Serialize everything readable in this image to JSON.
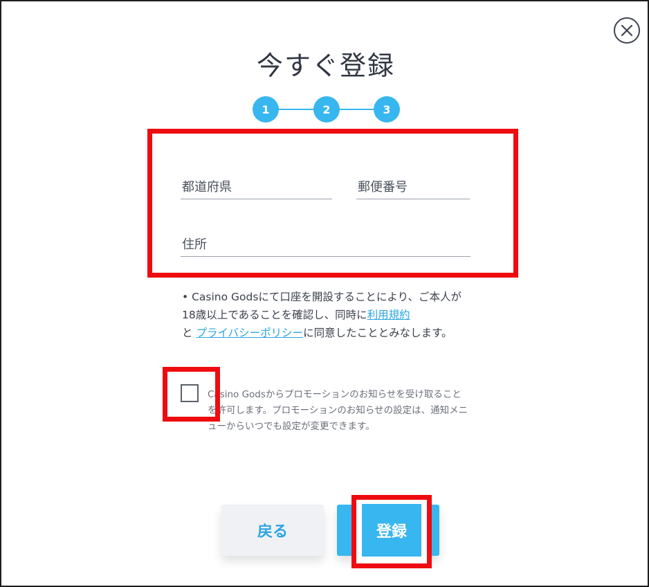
{
  "dialog": {
    "title": "今すぐ登録"
  },
  "stepper": {
    "steps": [
      "1",
      "2",
      "3"
    ]
  },
  "form": {
    "prefecture_placeholder": "都道府県",
    "postal_placeholder": "郵便番号",
    "address_placeholder": "住所"
  },
  "terms": {
    "prefix": "• Casino Godsにて口座を開設することにより、ご本人が18歳以上であることを確認し、同時に",
    "link_terms": "利用規約",
    "mid": "と ",
    "link_privacy": "プライバシーポリシー",
    "suffix": "に同意したこととみなします。"
  },
  "promo": {
    "text": "Casino Godsからプロモーションのお知らせを受け取ることを許可します。プロモーションのお知らせの設定は、通知メニューからいつでも設定が変更できます。",
    "checked": false
  },
  "buttons": {
    "back_label": "戻る",
    "register_label": "登録"
  },
  "colors": {
    "accent": "#38b6ef",
    "highlight": "#ee0c10"
  },
  "icons": {
    "close": "close-icon"
  }
}
